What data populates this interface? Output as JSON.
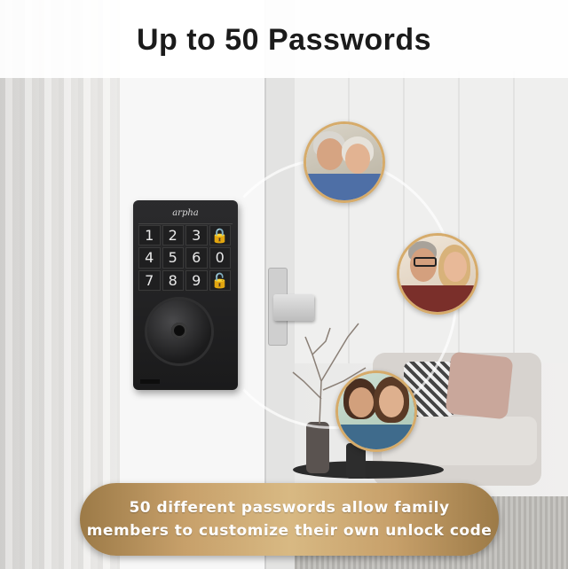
{
  "header": {
    "title": "Up to 50 Passwords"
  },
  "lock": {
    "brand": "arpha",
    "keys": [
      "1",
      "2",
      "3",
      "🔒",
      "4",
      "5",
      "6",
      "0",
      "7",
      "8",
      "9",
      "🔓"
    ]
  },
  "caption": {
    "line1": "50 different passwords allow family",
    "line2": "members to customize their own unlock code"
  },
  "icons": [
    "lock-icon",
    "unlock-icon"
  ],
  "colors": {
    "accent_gold": "#c7a06a",
    "title": "#1b1b1b",
    "caption_text": "#ffffff"
  }
}
